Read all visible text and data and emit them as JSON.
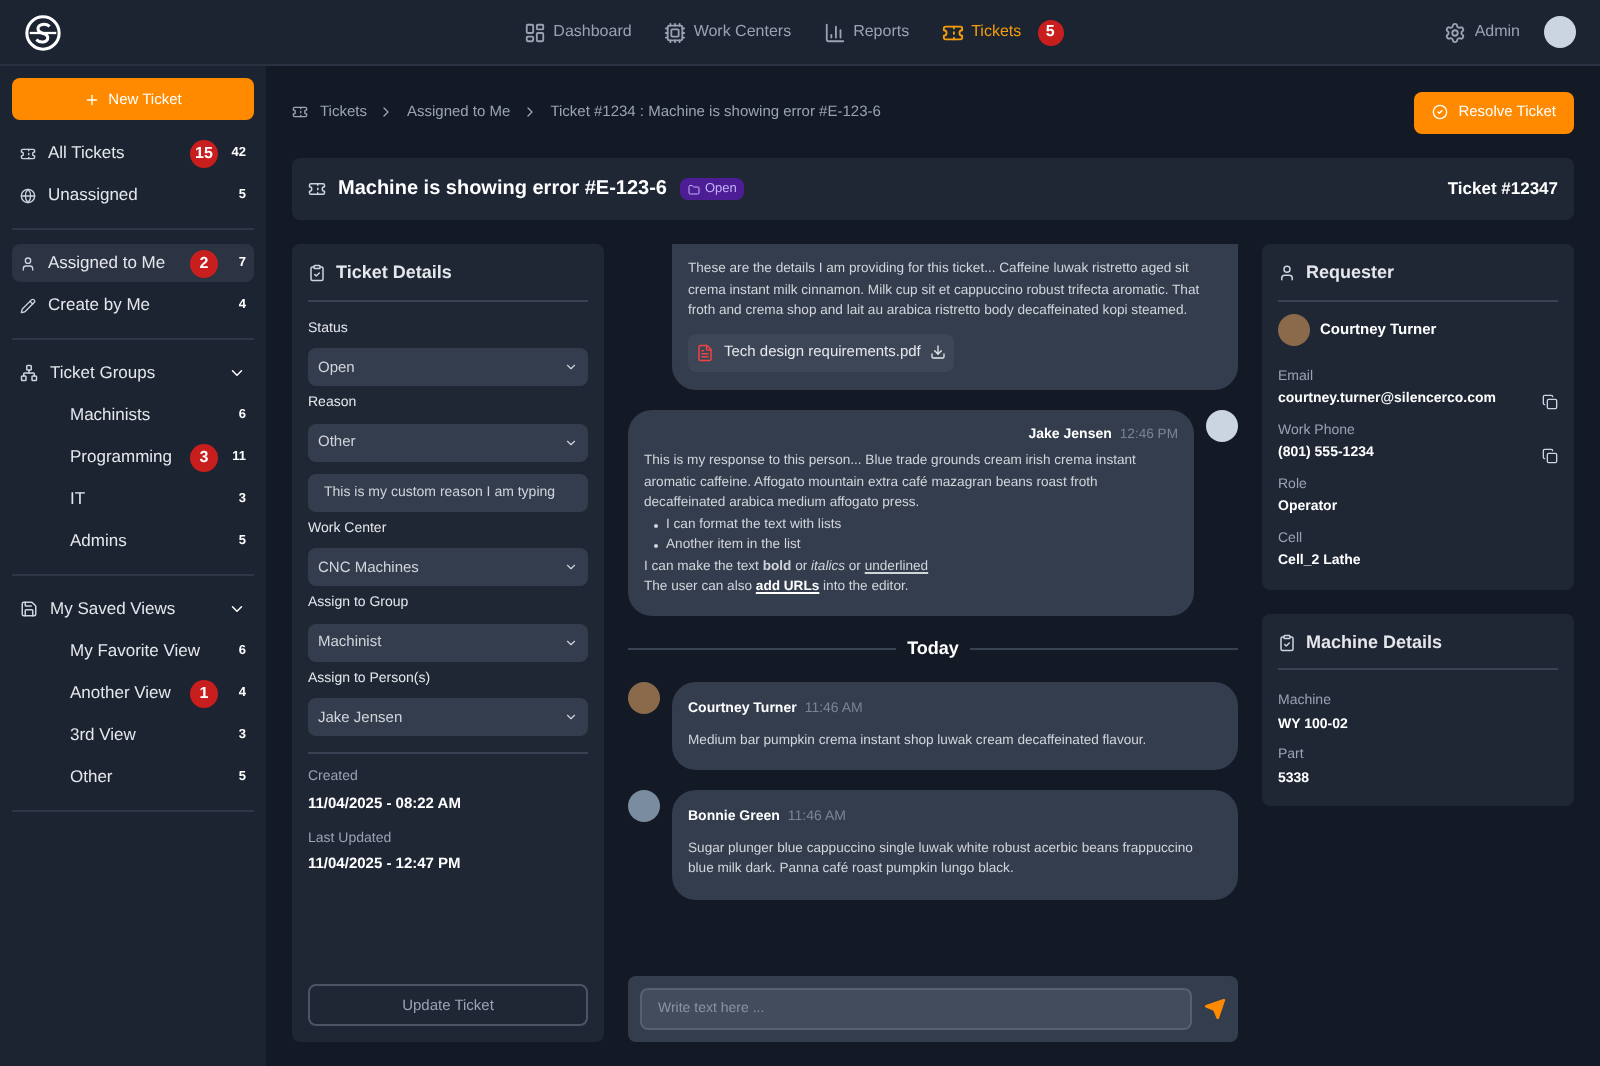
{
  "nav": [
    {
      "label": "Dashboard",
      "kind": "dashboard",
      "selected": false
    },
    {
      "label": "Work Centers",
      "kind": "center",
      "selected": false
    },
    {
      "label": "Reports",
      "kind": "reports",
      "selected": false
    },
    {
      "label": "Tickets",
      "kind": "tickets",
      "selected": true,
      "badge": "5"
    }
  ],
  "user": {
    "label": "Admin"
  },
  "sidebar": {
    "new_button": "New Ticket",
    "sections": [
      {
        "items": [
          {
            "label": "All Tickets",
            "kind": "tickets",
            "alert": "15",
            "count": "42",
            "selected": false
          },
          {
            "label": "Unassigned",
            "kind": "globe",
            "count": "5",
            "selected": false
          }
        ]
      },
      {
        "items": [
          {
            "label": "Assigned to Me",
            "kind": "user",
            "alert": "2",
            "count": "7",
            "selected": true
          },
          {
            "label": "Create by Me",
            "kind": "pencil",
            "count": "4",
            "selected": false
          }
        ]
      },
      {
        "title": "Ticket Groups",
        "kind": "groups",
        "expanded": true,
        "items": [
          {
            "label": "Machinists",
            "count": "6",
            "selected": false
          },
          {
            "label": "Programming",
            "alert": "3",
            "count": "11",
            "selected": false
          },
          {
            "label": "IT",
            "count": "3",
            "selected": false
          },
          {
            "label": "Admins",
            "count": "5",
            "selected": false
          }
        ]
      },
      {
        "title": "My Saved Views",
        "kind": "save",
        "expanded": true,
        "items": [
          {
            "label": "My Favorite View",
            "count": "6",
            "selected": false
          },
          {
            "label": "Another View",
            "alert": "1",
            "count": "4",
            "selected": false
          },
          {
            "label": "3rd View",
            "count": "3",
            "selected": false
          },
          {
            "label": "Other",
            "count": "5",
            "selected": false
          }
        ]
      }
    ]
  },
  "breadcrumb": [
    "Tickets",
    "Assigned to Me",
    "Ticket #1234 : Machine is showing error #E-123-6"
  ],
  "resolve_button": "Resolve Ticket",
  "ticket": {
    "title": "Machine is showing error #E-123-6",
    "status": "Open",
    "number": "Ticket #12347"
  },
  "details": {
    "title": "Ticket Details",
    "fields": [
      {
        "label": "Status",
        "value": "Open"
      },
      {
        "label": "Reason",
        "value": "Other",
        "custom": "This is my custom reason I am typing"
      },
      {
        "label": "Work Center",
        "value": "CNC Machines"
      },
      {
        "label": "Assign to Group",
        "value": "Machinist"
      },
      {
        "label": "Assign to Person(s)",
        "value": "Jake Jensen"
      }
    ],
    "dates": [
      {
        "label": "Created",
        "value": "11/04/2025 - 08:22 AM"
      },
      {
        "label": "Last Updated",
        "value": "11/04/2025 - 12:47 PM"
      }
    ],
    "button": "Update Ticket"
  },
  "chat": {
    "first": {
      "text": "These are the details I am providing for this ticket... Caffeine luwak ristretto aged sit crema instant milk cinnamon. Milk cup sit et cappuccino robust trifecta aromatic. That froth and crema shop and lait au arabica ristretto body decaffeinated kopi steamed.",
      "attachment": "Tech design requirements.pdf"
    },
    "reply": {
      "name": "Jake Jensen",
      "time": "12:46 PM",
      "text": "This is my response to this person... Blue trade grounds cream irish crema instant aromatic caffeine. Affogato mountain extra café mazagran beans roast froth decaffeinated arabica medium affogato press.",
      "bullets": [
        "I can format the text with lists",
        "Another item in the list"
      ],
      "format_line": {
        "text": "I can make the text **bold** or *italics* or",
        "underlined": "underlined"
      },
      "url_line": {
        "before": "The user can also",
        "link": "add URLs",
        "after": "into the editor."
      }
    },
    "divider": "Today",
    "messages": [
      {
        "name": "Courtney Turner",
        "time": "11:46 AM",
        "text": "Medium bar pumpkin crema instant shop luwak cream decaffeinated flavour."
      },
      {
        "name": "Bonnie Green",
        "time": "11:46 AM",
        "text": "Sugar plunger blue cappuccino single luwak white robust acerbic beans frappuccino blue milk dark. Panna café roast pumpkin lungo black."
      }
    ],
    "input": {
      "placeholder": "Write text here ..."
    }
  },
  "requester": {
    "title": "Requester",
    "name": "Courtney Turner",
    "fields": [
      {
        "label": "Email",
        "value": "courtney.turner@silencerco.com",
        "copy": true
      },
      {
        "label": "Work Phone",
        "value": "(801) 555-1234",
        "copy": true
      },
      {
        "label": "Role",
        "value": "Operator",
        "copy": false
      },
      {
        "label": "Cell",
        "value": "Cell_2 Lathe",
        "copy": false
      }
    ]
  },
  "machine": {
    "title": "Machine Details",
    "fields": [
      {
        "label": "Machine",
        "value": "WY 100-02"
      },
      {
        "label": "Part",
        "value": "5338"
      }
    ]
  }
}
